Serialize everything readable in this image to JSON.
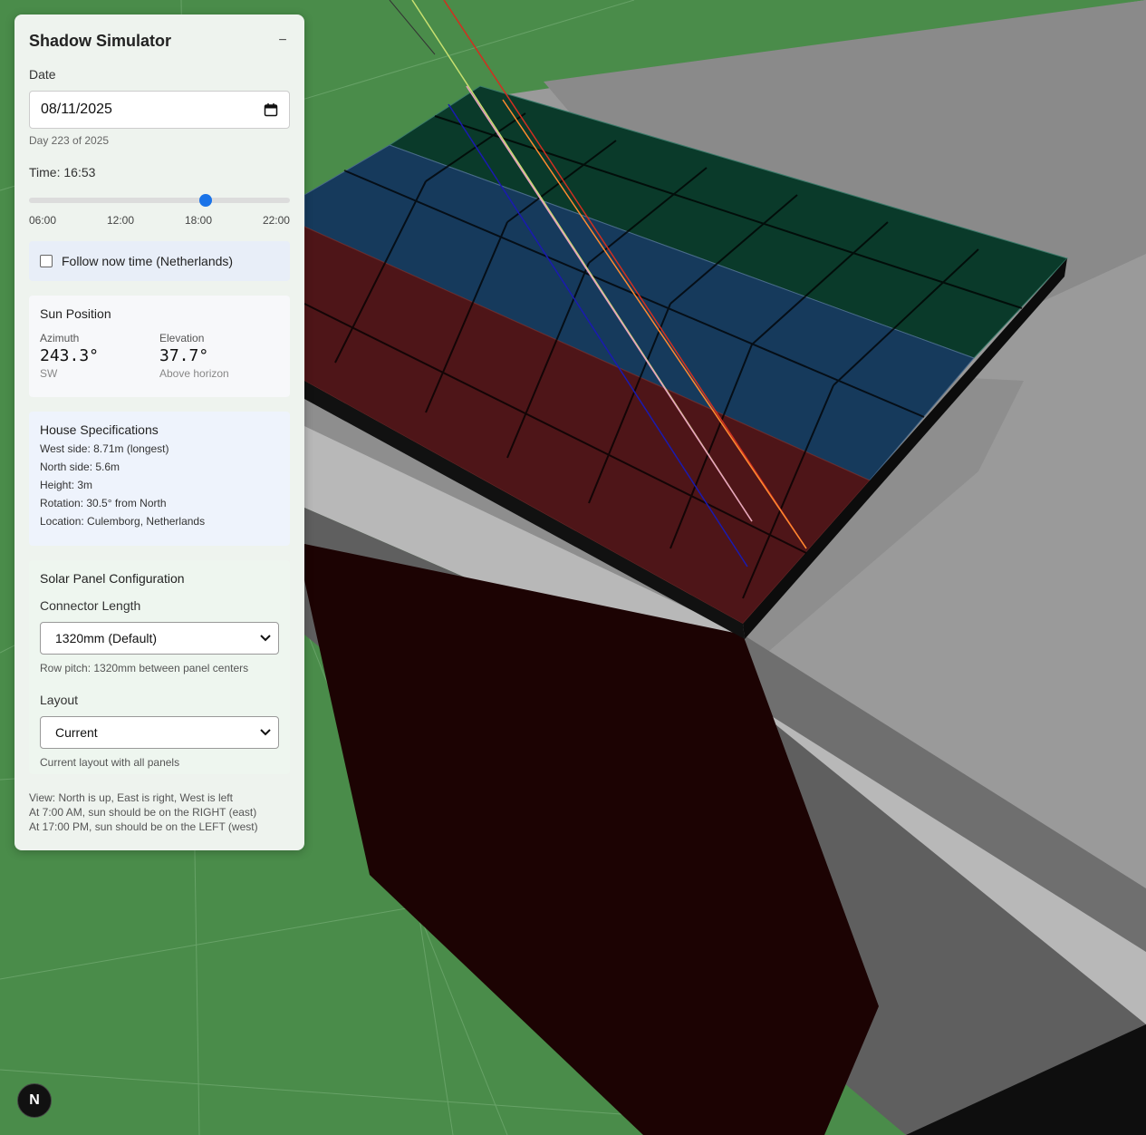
{
  "panel": {
    "title": "Shadow Simulator",
    "collapse_symbol": "−",
    "date": {
      "label": "Date",
      "value": "08/11/2025",
      "day_info": "Day 223 of 2025",
      "icon": "calendar-icon"
    },
    "time": {
      "label": "Time: 16:53",
      "slider_value_fraction": 0.677,
      "ticks": [
        "06:00",
        "12:00",
        "18:00",
        "22:00"
      ]
    },
    "follow": {
      "label": "Follow now time (Netherlands)",
      "checked": false
    },
    "sun_position": {
      "title": "Sun Position",
      "azimuth_label": "Azimuth",
      "azimuth_value": "243.3°",
      "azimuth_dir": "SW",
      "elevation_label": "Elevation",
      "elevation_value": "37.7°",
      "elevation_sub": "Above horizon"
    },
    "house": {
      "title": "House Specifications",
      "specs": [
        "West side: 8.71m (longest)",
        "North side: 5.6m",
        "Height: 3m",
        "Rotation: 30.5° from North",
        "Location: Culemborg, Netherlands"
      ]
    },
    "solar": {
      "title": "Solar Panel Configuration",
      "connector_label": "Connector Length",
      "connector_value": "1320mm (Default)",
      "connector_help": "Row pitch: 1320mm between panel centers",
      "layout_label": "Layout",
      "layout_value": "Current",
      "layout_help": "Current layout with all panels"
    },
    "notes": [
      "View: North is up, East is right, West is left",
      "At 7:00 AM, sun should be on the RIGHT (east)",
      "At 17:00 PM, sun should be on the LEFT (west)"
    ]
  },
  "badge": {
    "letter": "N"
  },
  "colors": {
    "ground": "#4a8c4a",
    "panel_green": "#0a3a2a",
    "panel_blue": "#163a5c",
    "panel_red": "#4e1518",
    "house_wall": "#1c0303",
    "accent": "#1a73e8"
  }
}
